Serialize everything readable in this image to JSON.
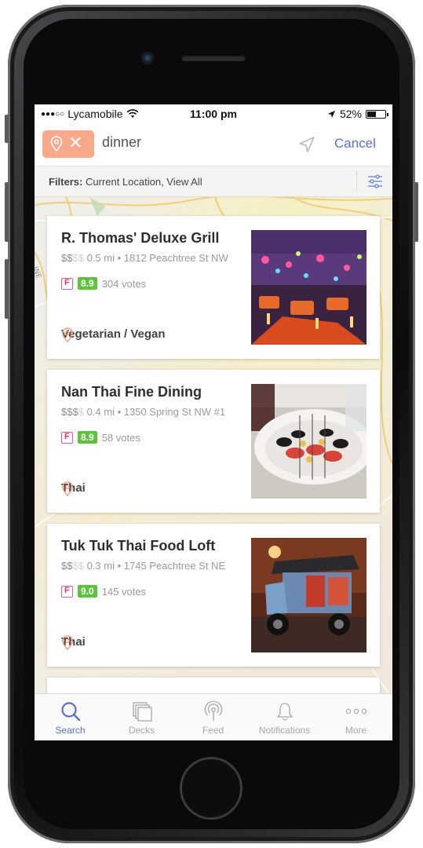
{
  "status_bar": {
    "carrier": "Lycamobile",
    "time": "11:00 pm",
    "battery_percent": "52%",
    "battery_level": 0.52
  },
  "search": {
    "query": "dinner",
    "cancel_label": "Cancel",
    "location_chip_icon": "pin-icon",
    "clear_icon": "close-icon"
  },
  "filters": {
    "label": "Filters:",
    "value": "Current Location, View All"
  },
  "results": [
    {
      "name": "R. Thomas' Deluxe Grill",
      "price_on": "$$",
      "price_off": "$$",
      "distance": "0.5 mi",
      "address": "1812 Peachtree St NW",
      "score": "8.9",
      "votes": "304 votes",
      "category": "Vegetarian / Vegan"
    },
    {
      "name": "Nan Thai Fine Dining",
      "price_on": "$$$",
      "price_off": "$",
      "distance": "0.4 mi",
      "address": "1350 Spring St NW #1",
      "score": "8.9",
      "votes": "58 votes",
      "category": "Thai"
    },
    {
      "name": "Tuk Tuk Thai Food Loft",
      "price_on": "$$",
      "price_off": "$$",
      "distance": "0.3 mi",
      "address": "1745 Peachtree St NE",
      "score": "9.0",
      "votes": "145 votes",
      "category": "Thai"
    }
  ],
  "tabs": [
    {
      "label": "Search",
      "icon": "search-icon",
      "active": true
    },
    {
      "label": "Decks",
      "icon": "decks-icon",
      "active": false
    },
    {
      "label": "Feed",
      "icon": "feed-icon",
      "active": false
    },
    {
      "label": "Notifications",
      "icon": "bell-icon",
      "active": false
    },
    {
      "label": "More",
      "icon": "more-icon",
      "active": false
    }
  ],
  "colors": {
    "accent": "#5b6fd6",
    "location_chip": "#f7a98a",
    "score_green": "#5cc33c",
    "foursquare_pink": "#e0306e"
  }
}
